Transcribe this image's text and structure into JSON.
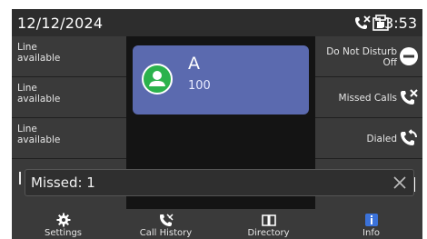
{
  "status": {
    "date": "12/12/2024",
    "time": "13:53"
  },
  "lines": [
    {
      "label": "Line\navailable"
    },
    {
      "label": "Line\navailable"
    },
    {
      "label": "Line\navailable"
    }
  ],
  "functions": [
    {
      "label": "Do Not Disturb\nOff",
      "icon": "minus-circle-icon"
    },
    {
      "label": "Missed Calls",
      "icon": "missed-call-icon"
    },
    {
      "label": "Dialed",
      "icon": "dialed-call-icon"
    }
  ],
  "contact": {
    "name": "A",
    "number": "100"
  },
  "toast": {
    "text": "Missed: 1"
  },
  "nav": [
    {
      "label": "Settings",
      "icon": "gear-icon"
    },
    {
      "label": "Call History",
      "icon": "call-history-icon"
    },
    {
      "label": "Directory",
      "icon": "book-icon"
    },
    {
      "label": "Info",
      "icon": "info-icon"
    }
  ],
  "colors": {
    "accent": "#5b6aaf",
    "avatar": "#2bb24c",
    "info": "#3b72d9"
  }
}
